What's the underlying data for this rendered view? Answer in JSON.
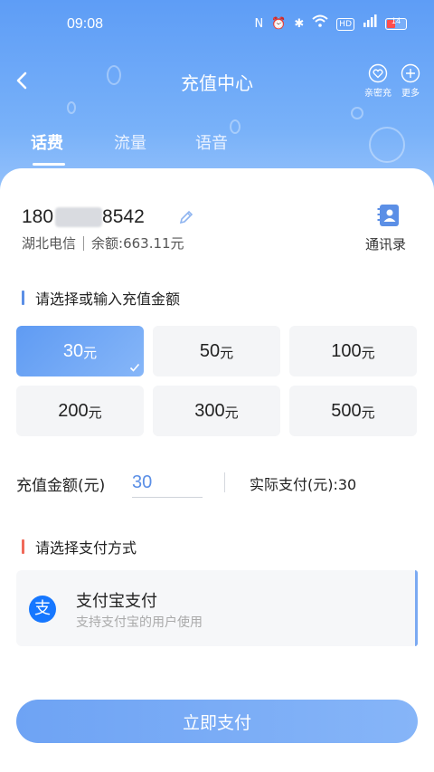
{
  "status_bar": {
    "time": "09:08",
    "icons": [
      "nfc-icon",
      "alarm-icon",
      "bluetooth-icon",
      "wifi-icon",
      "hd-icon",
      "signal-4g-icon"
    ],
    "battery_level": "14"
  },
  "navbar": {
    "title": "充值中心",
    "family_recharge_label": "亲密充",
    "more_label": "更多"
  },
  "tabs": [
    {
      "label": "话费",
      "active": true
    },
    {
      "label": "流量",
      "active": false
    },
    {
      "label": "语音",
      "active": false
    }
  ],
  "account": {
    "phone_prefix": "180",
    "phone_suffix": "8542",
    "carrier": "湖北电信",
    "balance": "余额:663.11元",
    "contacts_label": "通讯录"
  },
  "amount_section": {
    "title": "请选择或输入充值金额",
    "unit": "元",
    "options": [
      {
        "value": "30",
        "selected": true
      },
      {
        "value": "50",
        "selected": false
      },
      {
        "value": "100",
        "selected": false
      },
      {
        "value": "200",
        "selected": false
      },
      {
        "value": "300",
        "selected": false
      },
      {
        "value": "500",
        "selected": false
      }
    ]
  },
  "recharge": {
    "label": "充值金额(元)",
    "value": "30",
    "actual_pay": "实际支付(元):30"
  },
  "payment_section": {
    "title": "请选择支付方式",
    "method_name": "支付宝支付",
    "method_desc": "支持支付宝的用户使用",
    "method_icon_glyph": "支"
  },
  "submit": {
    "label": "立即支付"
  },
  "colors": {
    "accent": "#5e9df6",
    "section_bar_blue": "#5b8fe6",
    "section_bar_red": "#f06a5a",
    "alipay": "#1677ff"
  }
}
